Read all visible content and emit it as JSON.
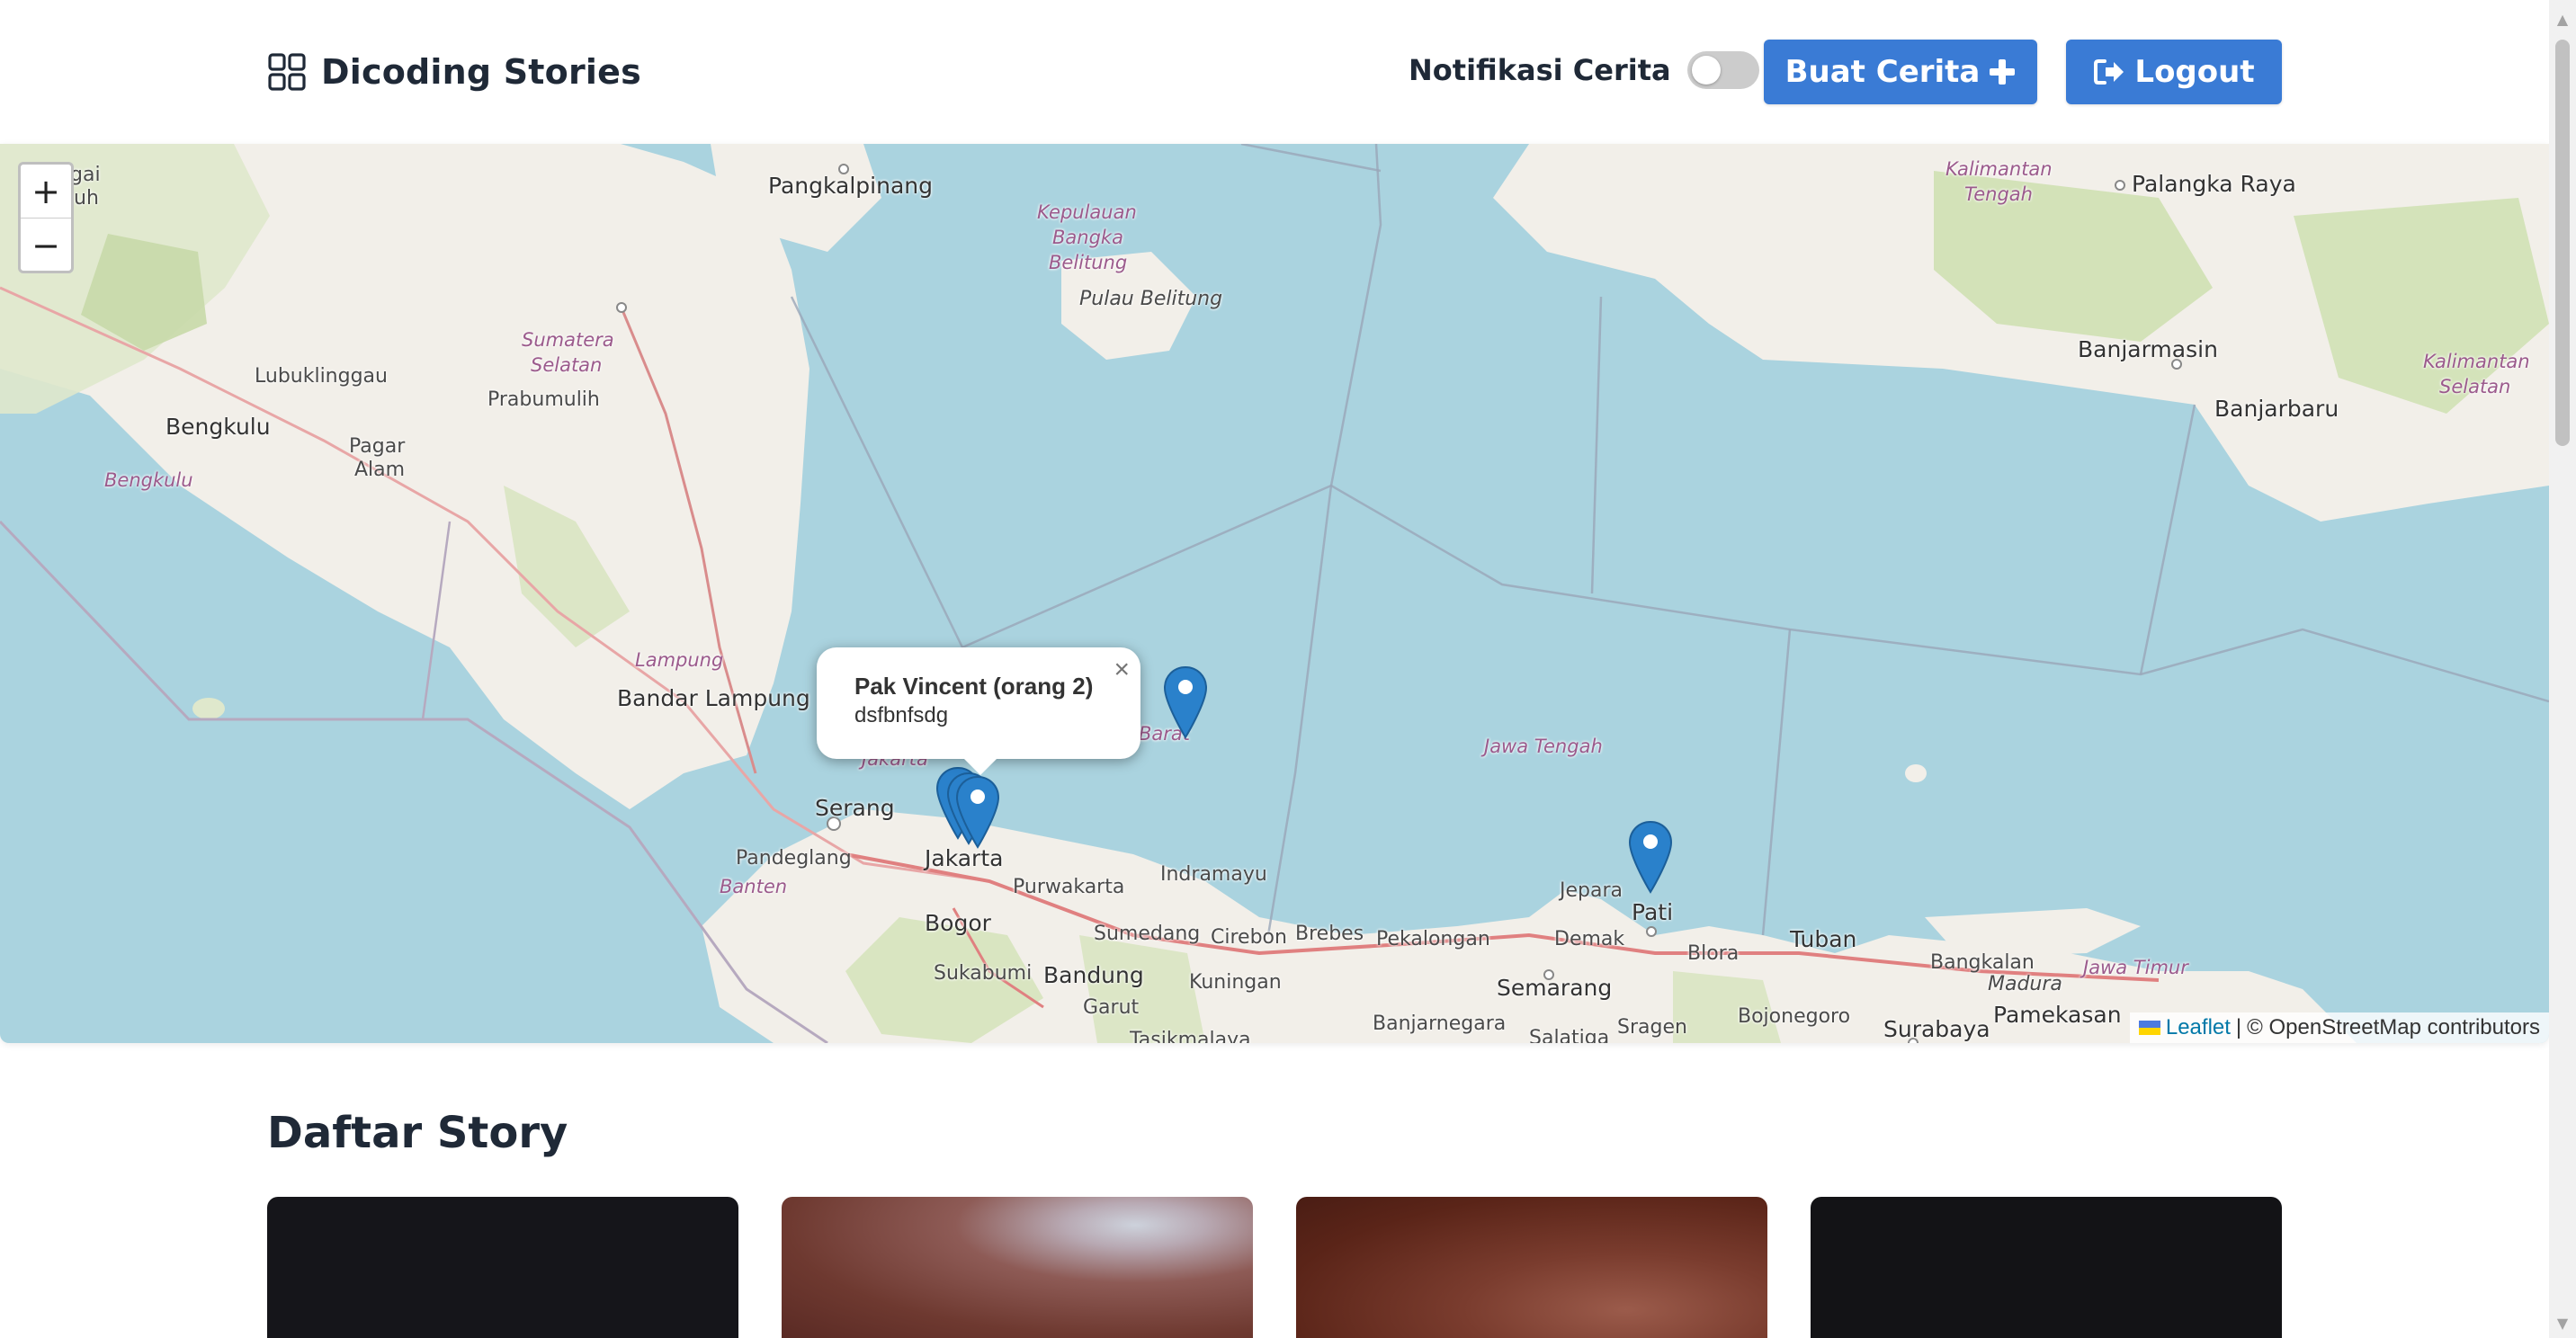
{
  "header": {
    "brand_title": "Dicoding Stories",
    "notification_label": "Notifikasi Cerita",
    "notification_enabled": false,
    "create_button_label": "Buat Cerita",
    "logout_button_label": "Logout"
  },
  "map": {
    "zoom_in_label": "+",
    "zoom_out_label": "−",
    "labels": {
      "pangkalpinang": "Pangkalpinang",
      "kepulauan": "Kepulauan",
      "bangka": "Bangka",
      "belitung": "Belitung",
      "pulau_belitung": "Pulau Belitung",
      "kalimantan_tengah_1": "Kalimantan",
      "kalimantan_tengah_2": "Tengah",
      "palangka_raya": "Palangka Raya",
      "gai": "gai",
      "uh": "uh",
      "sumatera_selatan_1": "Sumatera",
      "sumatera_selatan_2": "Selatan",
      "lubuklinggau": "Lubuklinggau",
      "prabumulih": "Prabumulih",
      "bengkulu_city": "Bengkulu",
      "bengkulu_region": "Bengkulu",
      "pagar": "Pagar",
      "alam": "Alam",
      "banjarmasin": "Banjarmasin",
      "banjarbaru": "Banjarbaru",
      "kalimantan_selatan_1": "Kalimantan",
      "kalimantan_selatan_2": "Selatan",
      "lampung": "Lampung",
      "bandar_lampung": "Bandar Lampung",
      "barat": "Barat",
      "jakarta_region": "Jakarta",
      "jawa_tengah": "Jawa Tengah",
      "serang": "Serang",
      "jakarta": "Jakarta",
      "pandeglang": "Pandeglang",
      "banten": "Banten",
      "purwakarta": "Purwakarta",
      "indramayu": "Indramayu",
      "bogor": "Bogor",
      "sumedang": "Sumedang",
      "cirebon": "Cirebon",
      "brebes": "Brebes",
      "pekalongan": "Pekalongan",
      "jepara": "Jepara",
      "pati": "Pati",
      "demak": "Demak",
      "blora": "Blora",
      "tuban": "Tuban",
      "bangkalan": "Bangkalan",
      "jawa_timur": "Jawa Timur",
      "madura": "Madura",
      "sukabumi": "Sukabumi",
      "bandung": "Bandung",
      "garut": "Garut",
      "kuningan": "Kuningan",
      "banjarnegara": "Banjarnegara",
      "semarang": "Semarang",
      "sragen": "Sragen",
      "bojonegoro": "Bojonegoro",
      "surabaya": "Surabaya",
      "pamekasan": "Pamekasan",
      "salatiga": "Salatiga",
      "tasikmalaya": "Tasikmalaya"
    },
    "popup": {
      "title": "Pak Vincent (orang 2)",
      "description": "dsfbnfsdg",
      "close_label": "×"
    },
    "attribution": {
      "leaflet_link": "Leaflet",
      "separator": "|",
      "osm_text": "© OpenStreetMap contributors"
    }
  },
  "stories": {
    "section_title": "Daftar Story"
  }
}
